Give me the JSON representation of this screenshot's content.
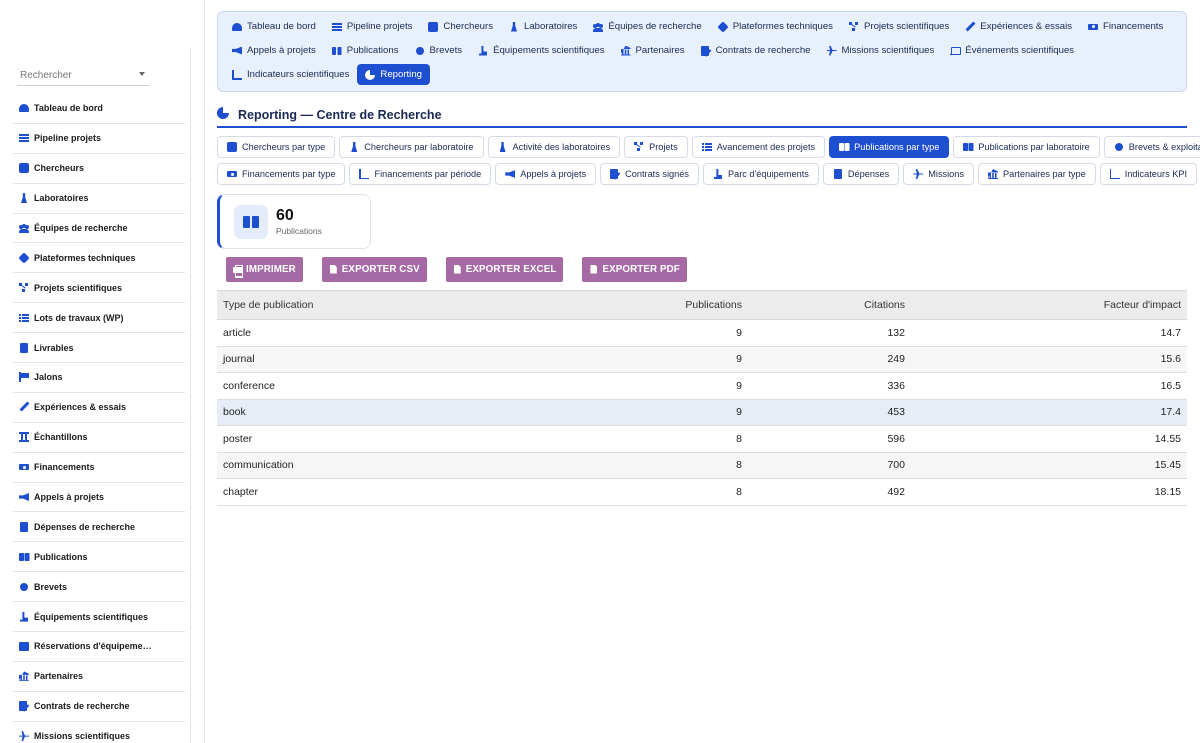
{
  "sidebar": {
    "search_placeholder": "Rechercher",
    "items": [
      {
        "label": "Tableau de bord",
        "icon": "dashboard-icon"
      },
      {
        "label": "Pipeline projets",
        "icon": "bars-icon"
      },
      {
        "label": "Chercheurs",
        "icon": "researcher-icon"
      },
      {
        "label": "Laboratoires",
        "icon": "flask-icon"
      },
      {
        "label": "Équipes de recherche",
        "icon": "people-icon"
      },
      {
        "label": "Plateformes techniques",
        "icon": "satellite-icon"
      },
      {
        "label": "Projets scientifiques",
        "icon": "project-diagram-icon"
      },
      {
        "label": "Lots de travaux (WP)",
        "icon": "list-icon"
      },
      {
        "label": "Livrables",
        "icon": "clipboard-check-icon"
      },
      {
        "label": "Jalons",
        "icon": "flag-icon"
      },
      {
        "label": "Expériences & essais",
        "icon": "pen-icon"
      },
      {
        "label": "Échantillons",
        "icon": "vials-icon"
      },
      {
        "label": "Financements",
        "icon": "money-icon"
      },
      {
        "label": "Appels à projets",
        "icon": "megaphone-icon"
      },
      {
        "label": "Dépenses de recherche",
        "icon": "receipt-icon"
      },
      {
        "label": "Publications",
        "icon": "book-icon"
      },
      {
        "label": "Brevets",
        "icon": "certificate-icon"
      },
      {
        "label": "Équipements scientifiques",
        "icon": "microscope-icon"
      },
      {
        "label": "Réservations d'équipeme…",
        "icon": "calendar-check-icon"
      },
      {
        "label": "Partenaires",
        "icon": "bank-icon"
      },
      {
        "label": "Contrats de recherche",
        "icon": "file-signature-icon"
      },
      {
        "label": "Missions scientifiques",
        "icon": "plane-icon"
      }
    ]
  },
  "topnav": {
    "rows": [
      [
        {
          "label": "Tableau de bord",
          "icon": "dashboard-icon"
        },
        {
          "label": "Pipeline projets",
          "icon": "bars-icon"
        },
        {
          "label": "Chercheurs",
          "icon": "researcher-icon"
        },
        {
          "label": "Laboratoires",
          "icon": "flask-icon"
        },
        {
          "label": "Équipes de recherche",
          "icon": "people-icon"
        },
        {
          "label": "Plateformes techniques",
          "icon": "satellite-icon"
        },
        {
          "label": "Projets scientifiques",
          "icon": "project-diagram-icon"
        },
        {
          "label": "Expériences & essais",
          "icon": "pen-icon"
        },
        {
          "label": "Financements",
          "icon": "money-icon"
        }
      ],
      [
        {
          "label": "Appels à projets",
          "icon": "megaphone-icon"
        },
        {
          "label": "Publications",
          "icon": "book-icon"
        },
        {
          "label": "Brevets",
          "icon": "certificate-icon"
        },
        {
          "label": "Équipements scientifiques",
          "icon": "microscope-icon"
        },
        {
          "label": "Partenaires",
          "icon": "bank-icon"
        },
        {
          "label": "Contrats de recherche",
          "icon": "file-signature-icon"
        },
        {
          "label": "Missions scientifiques",
          "icon": "plane-icon"
        },
        {
          "label": "Événements scientifiques",
          "icon": "laptop-icon"
        }
      ],
      [
        {
          "label": "Indicateurs scientifiques",
          "icon": "chart-line-icon"
        },
        {
          "label": "Reporting",
          "icon": "chart-pie-icon",
          "active": true
        }
      ]
    ]
  },
  "reporting": {
    "title": "Reporting — Centre de Recherche",
    "buttons": [
      [
        {
          "label": "Chercheurs par type",
          "icon": "researcher-icon"
        },
        {
          "label": "Chercheurs par laboratoire",
          "icon": "flask-icon"
        },
        {
          "label": "Activité des laboratoires",
          "icon": "flask-icon"
        },
        {
          "label": "Projets",
          "icon": "project-diagram-icon"
        },
        {
          "label": "Avancement des projets",
          "icon": "list-icon"
        },
        {
          "label": "Publications par type",
          "icon": "book-icon",
          "active": true
        },
        {
          "label": "Publications par laboratoire",
          "icon": "book-icon"
        },
        {
          "label": "Brevets & exploitation",
          "icon": "certificate-icon"
        }
      ],
      [
        {
          "label": "Financements par type",
          "icon": "money-icon"
        },
        {
          "label": "Financements par période",
          "icon": "chart-line-icon"
        },
        {
          "label": "Appels à projets",
          "icon": "megaphone-icon"
        },
        {
          "label": "Contrats signés",
          "icon": "file-signature-icon"
        },
        {
          "label": "Parc d'équipements",
          "icon": "microscope-icon"
        },
        {
          "label": "Dépenses",
          "icon": "receipt-icon"
        },
        {
          "label": "Missions",
          "icon": "plane-icon"
        },
        {
          "label": "Partenaires par type",
          "icon": "bank-icon"
        },
        {
          "label": "Indicateurs KPI",
          "icon": "chart-line-icon"
        }
      ]
    ],
    "kpi": {
      "value": "60",
      "label": "Publications",
      "icon": "book-icon"
    },
    "exports": [
      {
        "label": "IMPRIMER",
        "icon": "print-icon"
      },
      {
        "label": "EXPORTER CSV",
        "icon": "file-csv-icon"
      },
      {
        "label": "EXPORTER EXCEL",
        "icon": "file-excel-icon"
      },
      {
        "label": "EXPORTER PDF",
        "icon": "file-pdf-icon"
      }
    ],
    "table": {
      "headers": [
        "Type de publication",
        "Publications",
        "Citations",
        "Facteur d'impact"
      ],
      "rows": [
        [
          "article",
          "9",
          "132",
          "14.7"
        ],
        [
          "journal",
          "9",
          "249",
          "15.6"
        ],
        [
          "conference",
          "9",
          "336",
          "16.5"
        ],
        [
          "book",
          "9",
          "453",
          "17.4"
        ],
        [
          "poster",
          "8",
          "596",
          "14.55"
        ],
        [
          "communication",
          "8",
          "700",
          "15.45"
        ],
        [
          "chapter",
          "8",
          "492",
          "18.15"
        ]
      ]
    }
  },
  "colors": {
    "accent": "#1f4fd1",
    "export_button": "#a56aa6",
    "nav_bg": "#e8f0fb"
  }
}
